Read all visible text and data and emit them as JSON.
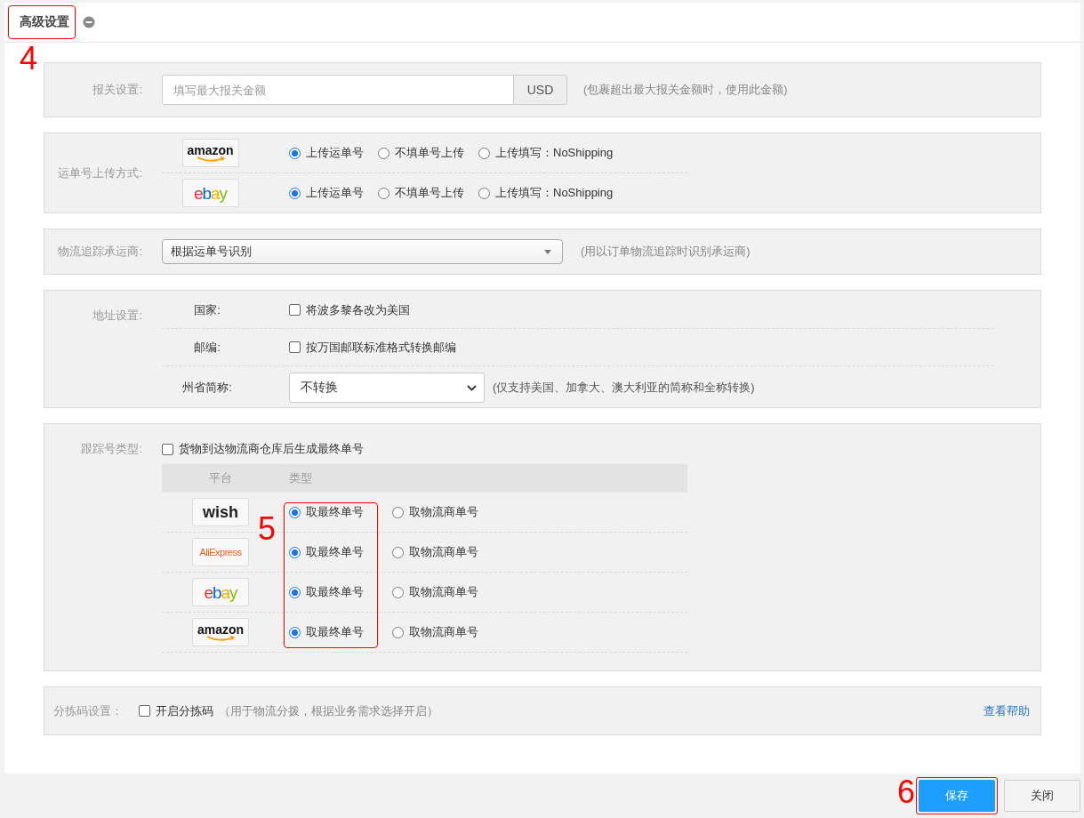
{
  "header": {
    "title": "高级设置",
    "annotation": "4"
  },
  "customs": {
    "label": "报关设置:",
    "placeholder": "填写最大报关金额",
    "addon": "USD",
    "hint": "(包裹超出最大报关金额时，使用此金额)"
  },
  "upload_method": {
    "label": "运单号上传方式:",
    "rows": [
      {
        "logo": {
          "kind": "amazon",
          "text": "amazon"
        },
        "options": [
          {
            "label": "上传运单号",
            "selected": true
          },
          {
            "label": "不填单号上传",
            "selected": false
          },
          {
            "label": "上传填写：NoShipping",
            "selected": false
          }
        ]
      },
      {
        "logo": {
          "kind": "ebay",
          "text": "ebay"
        },
        "options": [
          {
            "label": "上传运单号",
            "selected": true
          },
          {
            "label": "不填单号上传",
            "selected": false
          },
          {
            "label": "上传填写：NoShipping",
            "selected": false
          }
        ]
      }
    ]
  },
  "carrier": {
    "label": "物流追踪承运商:",
    "value": "根据运单号识别",
    "hint": "(用以订单物流追踪时识别承运商)"
  },
  "address": {
    "label": "地址设置:",
    "rows": [
      {
        "kind": "checkbox",
        "label": "国家:",
        "text": "将波多黎各改为美国",
        "checked": false
      },
      {
        "kind": "checkbox",
        "label": "邮编:",
        "text": "按万国邮联标准格式转换邮编",
        "checked": false
      },
      {
        "kind": "select",
        "label": "州省简称:",
        "value": "不转换",
        "hint": "(仅支持美国、加拿大、澳大利亚的简称和全称转换)"
      }
    ]
  },
  "tracking_type": {
    "label": "跟踪号类型:",
    "checkbox": {
      "text": "货物到达物流商仓库后生成最终单号",
      "checked": false
    },
    "columns": [
      "平台",
      "类型"
    ],
    "annotation": "5",
    "rows": [
      {
        "logo": {
          "kind": "wish",
          "text": "wish"
        },
        "options": [
          {
            "label": "取最终单号",
            "selected": true
          },
          {
            "label": "取物流商单号",
            "selected": false
          }
        ]
      },
      {
        "logo": {
          "kind": "aliexpress",
          "text": "AliExpress"
        },
        "options": [
          {
            "label": "取最终单号",
            "selected": true
          },
          {
            "label": "取物流商单号",
            "selected": false
          }
        ]
      },
      {
        "logo": {
          "kind": "ebay",
          "text": "ebay"
        },
        "options": [
          {
            "label": "取最终单号",
            "selected": true
          },
          {
            "label": "取物流商单号",
            "selected": false
          }
        ]
      },
      {
        "logo": {
          "kind": "amazon",
          "text": "amazon"
        },
        "options": [
          {
            "label": "取最终单号",
            "selected": true
          },
          {
            "label": "取物流商单号",
            "selected": false
          }
        ]
      }
    ]
  },
  "sorting": {
    "label": "分拣码设置：",
    "checkbox": {
      "text": "开启分拣码",
      "checked": false
    },
    "hint": "（用于物流分拨，根据业务需求选择开启）",
    "link": "查看帮助"
  },
  "footer": {
    "annotation": "6",
    "buttons": [
      {
        "label": "保存",
        "kind": "primary"
      },
      {
        "label": "关闭",
        "kind": "default"
      }
    ]
  }
}
